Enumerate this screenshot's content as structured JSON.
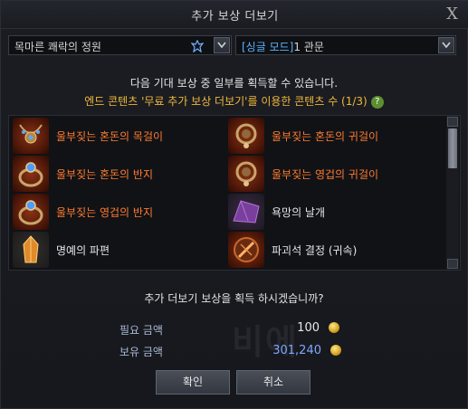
{
  "window": {
    "title": "추가 보상 더보기",
    "close_label": "X"
  },
  "dropdowns": {
    "dungeon": {
      "value": "목마른 쾌락의 정원"
    },
    "mode": {
      "mode_tag": "[싱글 모드]",
      "value": "1 관문"
    }
  },
  "info": {
    "line1": "다음 기대 보상 중 일부를 획득할 수 있습니다.",
    "line2": "엔드 콘텐츠 '무료 추가 보상 더보기'를 이용한 콘텐츠 수 (1/3)",
    "help_label": "?"
  },
  "rewards": [
    {
      "label": "울부짖는 혼돈의 목걸이",
      "icon": "necklace-icon",
      "highlight": true
    },
    {
      "label": "울부짖는 혼돈의 귀걸이",
      "icon": "earring-icon",
      "highlight": true
    },
    {
      "label": "울부짖는 혼돈의 반지",
      "icon": "ring-icon",
      "highlight": true
    },
    {
      "label": "울부짖는 영겁의 귀걸이",
      "icon": "earring-icon",
      "highlight": true
    },
    {
      "label": "울부짖는 영겁의 반지",
      "icon": "ring-icon",
      "highlight": true
    },
    {
      "label": "욕망의 날개",
      "icon": "wing-icon",
      "highlight": false
    },
    {
      "label": "명예의 파편",
      "icon": "shard-icon",
      "highlight": false
    },
    {
      "label": "파괴석 결정 (귀속)",
      "icon": "destruction-crystal-icon",
      "highlight": false
    }
  ],
  "confirm": {
    "question": "추가 더보기 보상을 획득 하시겠습니까?",
    "required_label": "필요 금액",
    "required_value": "100",
    "owned_label": "보유 금액",
    "owned_value": "301,240",
    "confirm_button": "확인",
    "cancel_button": "취소"
  },
  "colors": {
    "highlight_text": "#ff7a2f",
    "info_text": "#f0b83a",
    "mode_tag": "#59b4ff",
    "owned_value": "#7fa8ff",
    "help_badge": "#5c8f2f"
  }
}
